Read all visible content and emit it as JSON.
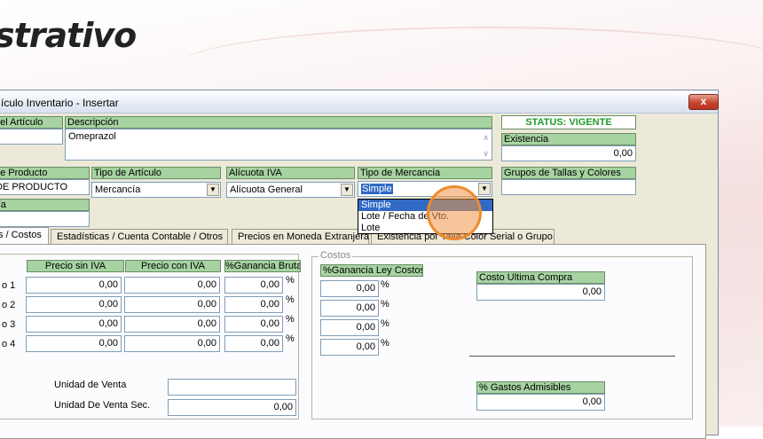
{
  "app": {
    "logo_text": "strativo"
  },
  "window": {
    "title": "ículo Inventario - Insertar",
    "close_label": "x"
  },
  "form": {
    "codigo_label": "del Artículo",
    "descripcion_label": "Descripción",
    "descripcion_value": "Omeprazol",
    "status_text": "STATUS: VIGENTE",
    "existencia_label": "Existencia",
    "existencia_value": "0,00",
    "tipo_producto_label": "de Producto",
    "tipo_producto_value": "DE PRODUCTO",
    "tipo_articulo_label": "Tipo de Artículo",
    "tipo_articulo_value": "Mercancía",
    "alicuota_label": "Alícuota IVA",
    "alicuota_value": "Alícuota General",
    "tipo_mercancia_label": "Tipo de Mercancia",
    "tipo_mercancia_value": "Simple",
    "grupos_label": "Grupos de Tallas y Colores",
    "categoria_label": "ría"
  },
  "dropdown": {
    "options": [
      "Simple",
      "Lote / Fecha de Vto.",
      "Lote"
    ],
    "highlighted": 0
  },
  "tabs": [
    {
      "label": "s / Costos"
    },
    {
      "label": "Estadísticas / Cuenta Contable / Otros"
    },
    {
      "label": "Precios en Moneda Extranjera"
    },
    {
      "label": "Existencia por Talla Color  Serial o Grupo"
    }
  ],
  "prices": {
    "col_sin_iva": "Precio sin IVA",
    "col_con_iva": "Precio con IVA",
    "col_ganancia": "%Ganancia Bruta",
    "rows": [
      {
        "label": "o 1",
        "sin_iva": "0,00",
        "con_iva": "0,00",
        "ganancia": "0,00"
      },
      {
        "label": "o 2",
        "sin_iva": "0,00",
        "con_iva": "0,00",
        "ganancia": "0,00"
      },
      {
        "label": "o 3",
        "sin_iva": "0,00",
        "con_iva": "0,00",
        "ganancia": "0,00"
      },
      {
        "label": "o 4",
        "sin_iva": "0,00",
        "con_iva": "0,00",
        "ganancia": "0,00"
      }
    ],
    "percent_symbol": "%",
    "unidad_venta_label": "Unidad de Venta",
    "unidad_venta_value": "",
    "unidad_venta_sec_label": "Unidad De Venta Sec.",
    "unidad_venta_sec_value": "0,00"
  },
  "costos": {
    "group_title": "Costos",
    "ganancia_ley_label": "%Ganancia Ley Costos",
    "ganancia_ley_values": [
      "0,00",
      "0,00",
      "0,00",
      "0,00"
    ],
    "costo_ultima_label": "Costo Ultima Compra",
    "costo_ultima_value": "0,00",
    "gastos_label": "% Gastos Admisibles",
    "gastos_value": "0,00"
  }
}
